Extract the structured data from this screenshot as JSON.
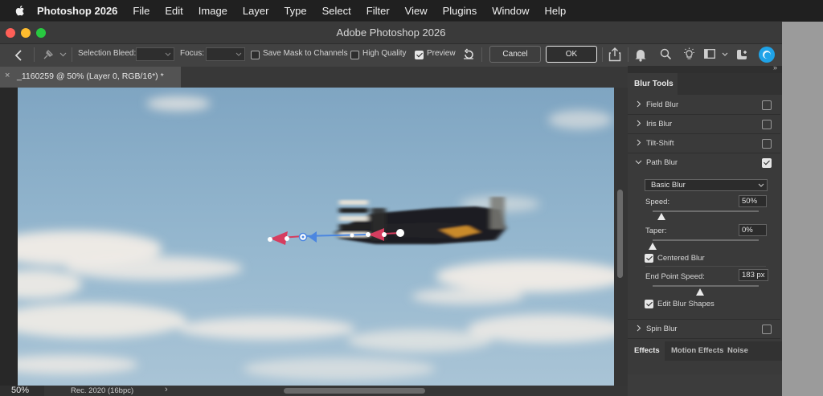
{
  "menubar": {
    "app_name": "Photoshop 2026",
    "items": [
      "File",
      "Edit",
      "Image",
      "Layer",
      "Type",
      "Select",
      "Filter",
      "View",
      "Plugins",
      "Window",
      "Help"
    ]
  },
  "window": {
    "title": "Adobe Photoshop 2026"
  },
  "options_bar": {
    "selection_bleed_label": "Selection Bleed:",
    "focus_label": "Focus:",
    "save_mask_label": "Save Mask to Channels",
    "save_mask_checked": false,
    "high_quality_label": "High Quality",
    "high_quality_checked": false,
    "preview_label": "Preview",
    "preview_checked": true,
    "cancel_label": "Cancel",
    "ok_label": "OK"
  },
  "document": {
    "tab_title": "_1160259 @ 50% (Layer 0, RGB/16*) *",
    "close_glyph": "×"
  },
  "status_bar": {
    "zoom": "50%",
    "doc_info": "Rec. 2020 (16bpc)",
    "more_glyph": "›"
  },
  "blur_panel": {
    "tab_label": "Blur Tools",
    "collapse_glyph": "»",
    "rows": [
      {
        "label": "Field Blur",
        "checked": false,
        "expanded": false
      },
      {
        "label": "Iris Blur",
        "checked": false,
        "expanded": false
      },
      {
        "label": "Tilt-Shift",
        "checked": false,
        "expanded": false
      },
      {
        "label": "Path Blur",
        "checked": true,
        "expanded": true
      }
    ],
    "path_blur": {
      "mode": "Basic Blur",
      "speed_label": "Speed:",
      "speed_value": "50%",
      "speed_fraction": 0.08,
      "taper_label": "Taper:",
      "taper_value": "0%",
      "taper_fraction": 0,
      "centered_blur_label": "Centered Blur",
      "centered_blur_checked": true,
      "end_point_speed_label": "End Point Speed:",
      "end_point_speed_value": "183 px",
      "end_point_speed_fraction": 0.45,
      "edit_blur_shapes_label": "Edit Blur Shapes",
      "edit_blur_shapes_checked": true
    },
    "spin_blur": {
      "label": "Spin Blur",
      "checked": false
    }
  },
  "effects_panel": {
    "tabs": [
      "Effects",
      "Motion Effects",
      "Noise"
    ],
    "active_tab": 0
  },
  "colors": {
    "menubar_bg": "#202020",
    "panel_bg": "#3a3a3a",
    "sky": "#8fb3cc",
    "blur_arrow_red": "#d63d5f",
    "blur_arrow_blue": "#4b86e0",
    "cc_accent": "#1fa3e8"
  }
}
